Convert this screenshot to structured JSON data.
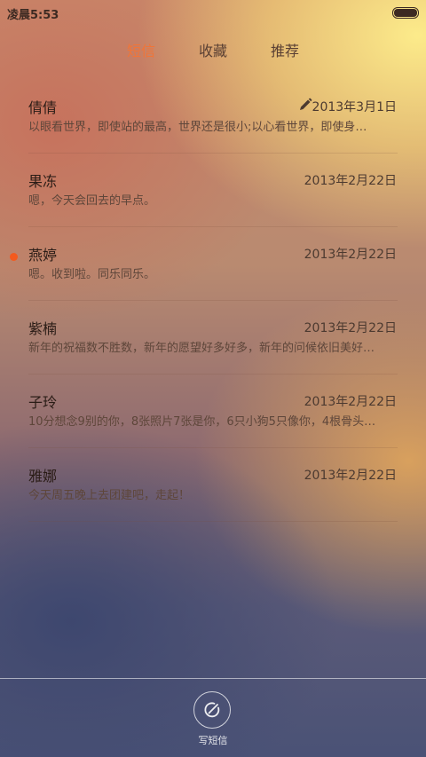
{
  "status_bar": {
    "time": "凌晨5:53"
  },
  "tabs": [
    {
      "label": "短信",
      "active": true
    },
    {
      "label": "收藏",
      "active": false
    },
    {
      "label": "推荐",
      "active": false
    }
  ],
  "conversations": [
    {
      "name": "倩倩",
      "date": "2013年3月1日",
      "preview": "以眼看世界，即使站的最高，世界还是很小;以心看世界，即使身…",
      "draft": true,
      "unread": false
    },
    {
      "name": "果冻",
      "date": "2013年2月22日",
      "preview": "嗯，今天会回去的早点。",
      "draft": false,
      "unread": false
    },
    {
      "name": "燕婷",
      "date": "2013年2月22日",
      "preview": "嗯。收到啦。同乐同乐。",
      "draft": false,
      "unread": true
    },
    {
      "name": "紫楠",
      "date": "2013年2月22日",
      "preview": "新年的祝福数不胜数，新年的愿望好多好多，新年的问候依旧美好…",
      "draft": false,
      "unread": false
    },
    {
      "name": "子玲",
      "date": "2013年2月22日",
      "preview": "10分想念9别的你，8张照片7张是你，6只小狗5只像你，4根骨头…",
      "draft": false,
      "unread": false
    },
    {
      "name": "雅娜",
      "date": "2013年2月22日",
      "preview": "今天周五晚上去团建吧，走起！",
      "draft": false,
      "unread": false
    }
  ],
  "compose": {
    "label": "写短信"
  },
  "colors": {
    "accent": "#f07538",
    "unread_dot": "#f35a1e"
  }
}
